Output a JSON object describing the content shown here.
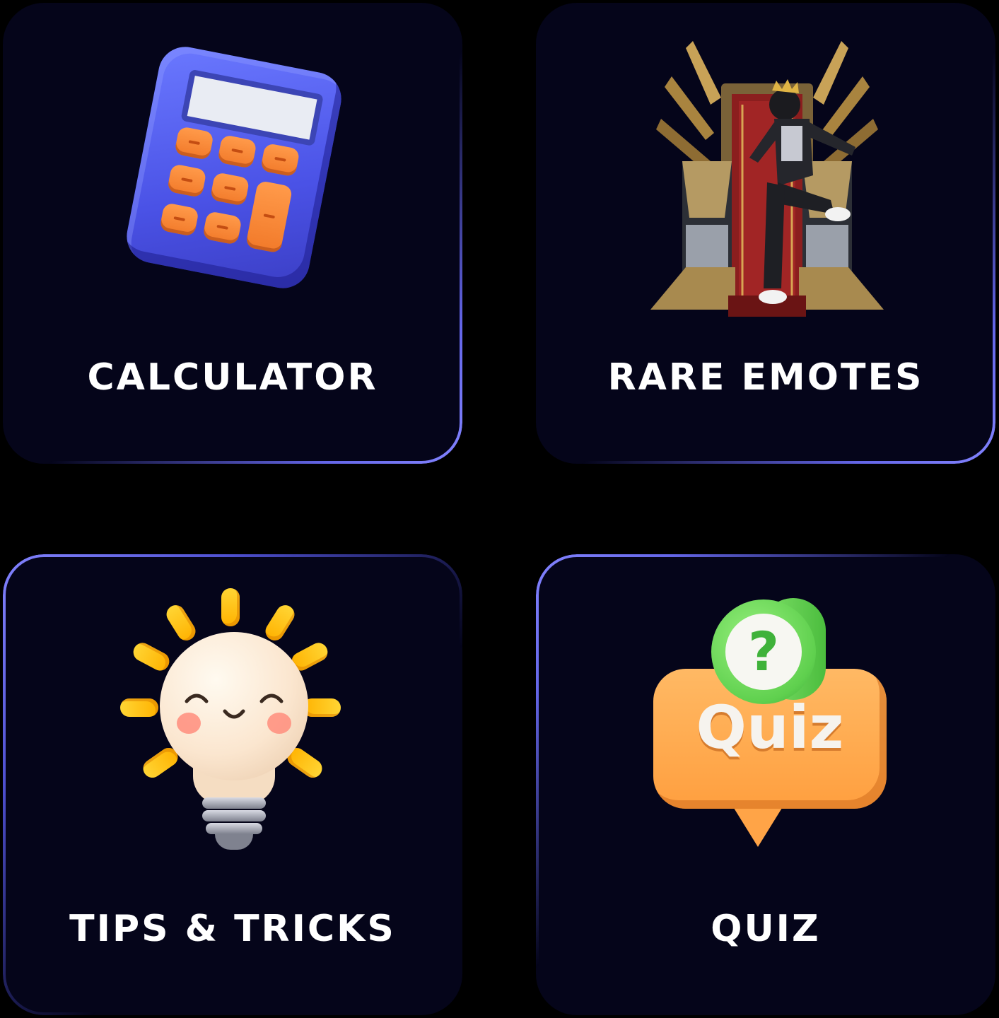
{
  "tiles": [
    {
      "label": "CALCULATOR",
      "icon": "calculator-icon"
    },
    {
      "label": "RARE EMOTES",
      "icon": "throne-character-icon"
    },
    {
      "label": "TIPS & TRICKS",
      "icon": "lightbulb-icon"
    },
    {
      "label": "QUIZ",
      "icon": "quiz-bubble-icon"
    }
  ],
  "quiz_art": {
    "text": "Quiz",
    "badge": "?"
  },
  "colors": {
    "background": "#000000",
    "tile": "#05051a",
    "glow": "#6466e8",
    "label": "#ffffff"
  }
}
